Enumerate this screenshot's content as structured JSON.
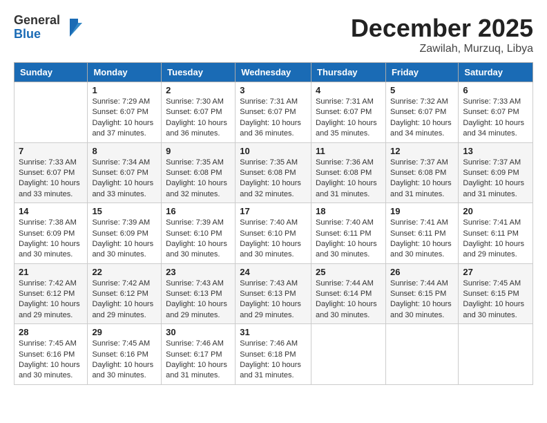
{
  "logo": {
    "general": "General",
    "blue": "Blue"
  },
  "header": {
    "month": "December 2025",
    "location": "Zawilah, Murzuq, Libya"
  },
  "days_of_week": [
    "Sunday",
    "Monday",
    "Tuesday",
    "Wednesday",
    "Thursday",
    "Friday",
    "Saturday"
  ],
  "weeks": [
    [
      {
        "day": "",
        "content": ""
      },
      {
        "day": "1",
        "content": "Sunrise: 7:29 AM\nSunset: 6:07 PM\nDaylight: 10 hours\nand 37 minutes."
      },
      {
        "day": "2",
        "content": "Sunrise: 7:30 AM\nSunset: 6:07 PM\nDaylight: 10 hours\nand 36 minutes."
      },
      {
        "day": "3",
        "content": "Sunrise: 7:31 AM\nSunset: 6:07 PM\nDaylight: 10 hours\nand 36 minutes."
      },
      {
        "day": "4",
        "content": "Sunrise: 7:31 AM\nSunset: 6:07 PM\nDaylight: 10 hours\nand 35 minutes."
      },
      {
        "day": "5",
        "content": "Sunrise: 7:32 AM\nSunset: 6:07 PM\nDaylight: 10 hours\nand 34 minutes."
      },
      {
        "day": "6",
        "content": "Sunrise: 7:33 AM\nSunset: 6:07 PM\nDaylight: 10 hours\nand 34 minutes."
      }
    ],
    [
      {
        "day": "7",
        "content": "Sunrise: 7:33 AM\nSunset: 6:07 PM\nDaylight: 10 hours\nand 33 minutes."
      },
      {
        "day": "8",
        "content": "Sunrise: 7:34 AM\nSunset: 6:07 PM\nDaylight: 10 hours\nand 33 minutes."
      },
      {
        "day": "9",
        "content": "Sunrise: 7:35 AM\nSunset: 6:08 PM\nDaylight: 10 hours\nand 32 minutes."
      },
      {
        "day": "10",
        "content": "Sunrise: 7:35 AM\nSunset: 6:08 PM\nDaylight: 10 hours\nand 32 minutes."
      },
      {
        "day": "11",
        "content": "Sunrise: 7:36 AM\nSunset: 6:08 PM\nDaylight: 10 hours\nand 31 minutes."
      },
      {
        "day": "12",
        "content": "Sunrise: 7:37 AM\nSunset: 6:08 PM\nDaylight: 10 hours\nand 31 minutes."
      },
      {
        "day": "13",
        "content": "Sunrise: 7:37 AM\nSunset: 6:09 PM\nDaylight: 10 hours\nand 31 minutes."
      }
    ],
    [
      {
        "day": "14",
        "content": "Sunrise: 7:38 AM\nSunset: 6:09 PM\nDaylight: 10 hours\nand 30 minutes."
      },
      {
        "day": "15",
        "content": "Sunrise: 7:39 AM\nSunset: 6:09 PM\nDaylight: 10 hours\nand 30 minutes."
      },
      {
        "day": "16",
        "content": "Sunrise: 7:39 AM\nSunset: 6:10 PM\nDaylight: 10 hours\nand 30 minutes."
      },
      {
        "day": "17",
        "content": "Sunrise: 7:40 AM\nSunset: 6:10 PM\nDaylight: 10 hours\nand 30 minutes."
      },
      {
        "day": "18",
        "content": "Sunrise: 7:40 AM\nSunset: 6:11 PM\nDaylight: 10 hours\nand 30 minutes."
      },
      {
        "day": "19",
        "content": "Sunrise: 7:41 AM\nSunset: 6:11 PM\nDaylight: 10 hours\nand 30 minutes."
      },
      {
        "day": "20",
        "content": "Sunrise: 7:41 AM\nSunset: 6:11 PM\nDaylight: 10 hours\nand 29 minutes."
      }
    ],
    [
      {
        "day": "21",
        "content": "Sunrise: 7:42 AM\nSunset: 6:12 PM\nDaylight: 10 hours\nand 29 minutes."
      },
      {
        "day": "22",
        "content": "Sunrise: 7:42 AM\nSunset: 6:12 PM\nDaylight: 10 hours\nand 29 minutes."
      },
      {
        "day": "23",
        "content": "Sunrise: 7:43 AM\nSunset: 6:13 PM\nDaylight: 10 hours\nand 29 minutes."
      },
      {
        "day": "24",
        "content": "Sunrise: 7:43 AM\nSunset: 6:13 PM\nDaylight: 10 hours\nand 29 minutes."
      },
      {
        "day": "25",
        "content": "Sunrise: 7:44 AM\nSunset: 6:14 PM\nDaylight: 10 hours\nand 30 minutes."
      },
      {
        "day": "26",
        "content": "Sunrise: 7:44 AM\nSunset: 6:15 PM\nDaylight: 10 hours\nand 30 minutes."
      },
      {
        "day": "27",
        "content": "Sunrise: 7:45 AM\nSunset: 6:15 PM\nDaylight: 10 hours\nand 30 minutes."
      }
    ],
    [
      {
        "day": "28",
        "content": "Sunrise: 7:45 AM\nSunset: 6:16 PM\nDaylight: 10 hours\nand 30 minutes."
      },
      {
        "day": "29",
        "content": "Sunrise: 7:45 AM\nSunset: 6:16 PM\nDaylight: 10 hours\nand 30 minutes."
      },
      {
        "day": "30",
        "content": "Sunrise: 7:46 AM\nSunset: 6:17 PM\nDaylight: 10 hours\nand 31 minutes."
      },
      {
        "day": "31",
        "content": "Sunrise: 7:46 AM\nSunset: 6:18 PM\nDaylight: 10 hours\nand 31 minutes."
      },
      {
        "day": "",
        "content": ""
      },
      {
        "day": "",
        "content": ""
      },
      {
        "day": "",
        "content": ""
      }
    ]
  ]
}
